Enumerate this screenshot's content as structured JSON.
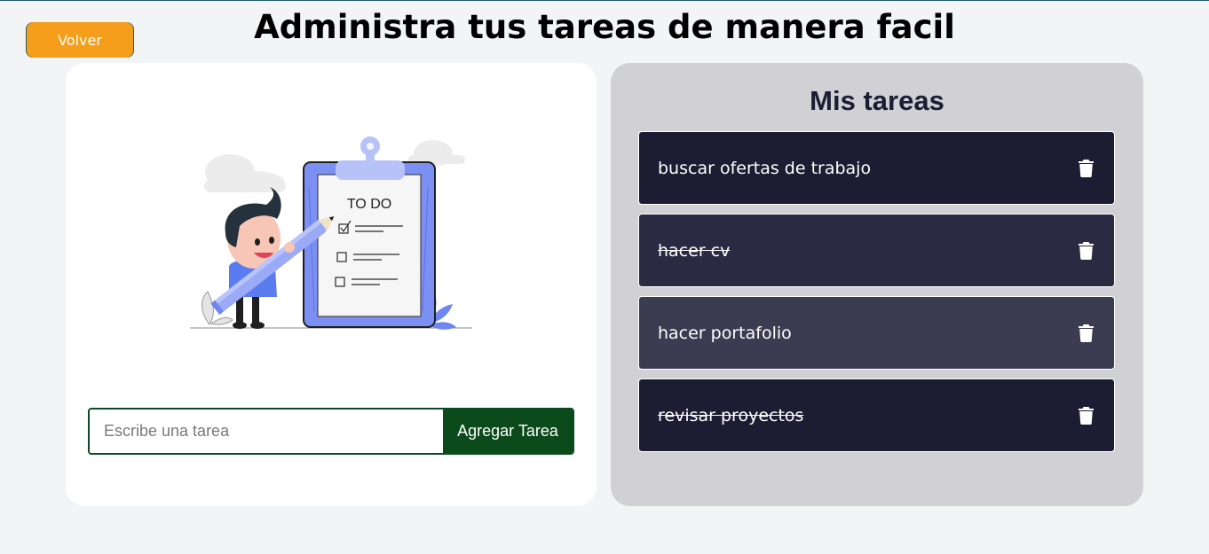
{
  "header": {
    "back_label": "Volver",
    "title": "Administra tus tareas de manera facil"
  },
  "form": {
    "input_placeholder": "Escribe una tarea",
    "input_value": "",
    "add_label": "Agregar Tarea"
  },
  "illustration": {
    "clipboard_heading": "TO DO"
  },
  "tasks_panel": {
    "title": "Mis tareas",
    "tasks": [
      {
        "text": "buscar ofertas de trabajo",
        "completed": false,
        "bg": "#1c1c32"
      },
      {
        "text": "hacer cv",
        "completed": true,
        "bg": "#2a2a43"
      },
      {
        "text": "hacer portafolio",
        "completed": false,
        "bg": "#3b3b52"
      },
      {
        "text": "revisar proyectos",
        "completed": true,
        "bg": "#1c1c32"
      }
    ]
  },
  "colors": {
    "accent_orange": "#f59e1b",
    "form_green": "#0b4a1b",
    "panel_bg": "#d1d0d4"
  }
}
